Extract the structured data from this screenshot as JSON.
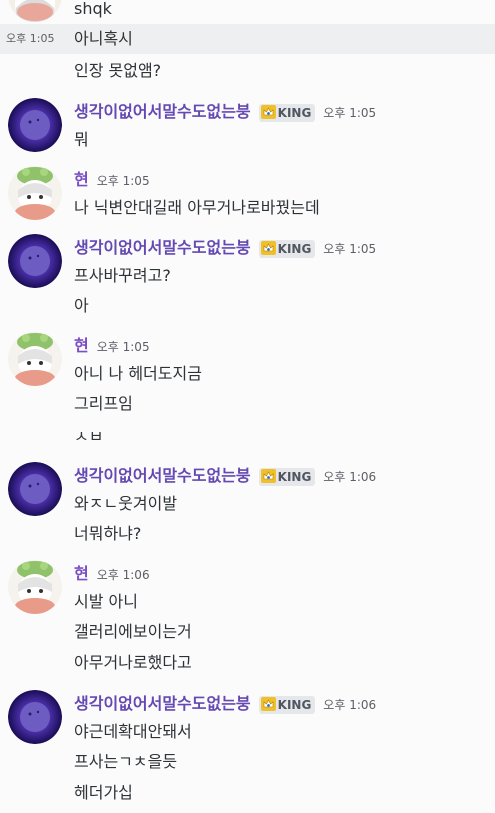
{
  "top": {
    "username": "shqk",
    "hover_time": "오후 1:05",
    "lines": [
      "아니혹시",
      "인장 못없앰?"
    ]
  },
  "groups": [
    {
      "user": "생각이없어서말수도없는붕",
      "badge": "KING",
      "time": "오후 1:05",
      "lines": [
        "뭐"
      ]
    },
    {
      "user": "현",
      "time": "오후 1:05",
      "lines": [
        "나 닉변안대길래 아무거나로바꿨는데"
      ]
    },
    {
      "user": "생각이없어서말수도없는붕",
      "badge": "KING",
      "time": "오후 1:05",
      "lines": [
        "프사바꾸려고?",
        "아"
      ]
    },
    {
      "user": "현",
      "time": "오후 1:05",
      "lines": [
        "아니 나 헤더도지금",
        "그리프임",
        "ㅅㅂ"
      ]
    },
    {
      "user": "생각이없어서말수도없는붕",
      "badge": "KING",
      "time": "오후 1:06",
      "lines": [
        "와ㅈㄴ웃겨이발",
        "너뭐하냐?"
      ]
    },
    {
      "user": "현",
      "time": "오후 1:06",
      "lines": [
        "시발 아니",
        "갤러리에보이는거",
        "아무거나로했다고"
      ]
    },
    {
      "user": "생각이없어서말수도없는붕",
      "badge": "KING",
      "time": "오후 1:06",
      "lines": [
        "야근데확대안돼서",
        "프사는ㄱㅊ을듯",
        "헤더가십"
      ]
    }
  ]
}
